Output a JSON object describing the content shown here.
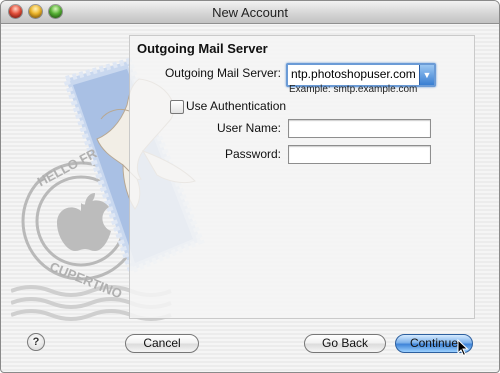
{
  "window": {
    "title": "New Account"
  },
  "section": {
    "title": "Outgoing Mail Server"
  },
  "outgoing_server": {
    "label": "Outgoing Mail Server:",
    "value": "ntp.photoshopuser.com",
    "example": "Example: smtp.example.com"
  },
  "authentication": {
    "label": "Use Authentication",
    "checked": false
  },
  "username": {
    "label": "User Name:",
    "value": ""
  },
  "password": {
    "label": "Password:",
    "value": ""
  },
  "buttons": {
    "help": "?",
    "cancel": "Cancel",
    "go_back": "Go Back",
    "continue": "Continue"
  },
  "illustration": {
    "stamp_text_top": "HELLO FR",
    "stamp_text_bottom": "CUPERTINO"
  },
  "colors": {
    "accent": "#3f84d8",
    "focus_ring": "#6b9bd6"
  }
}
